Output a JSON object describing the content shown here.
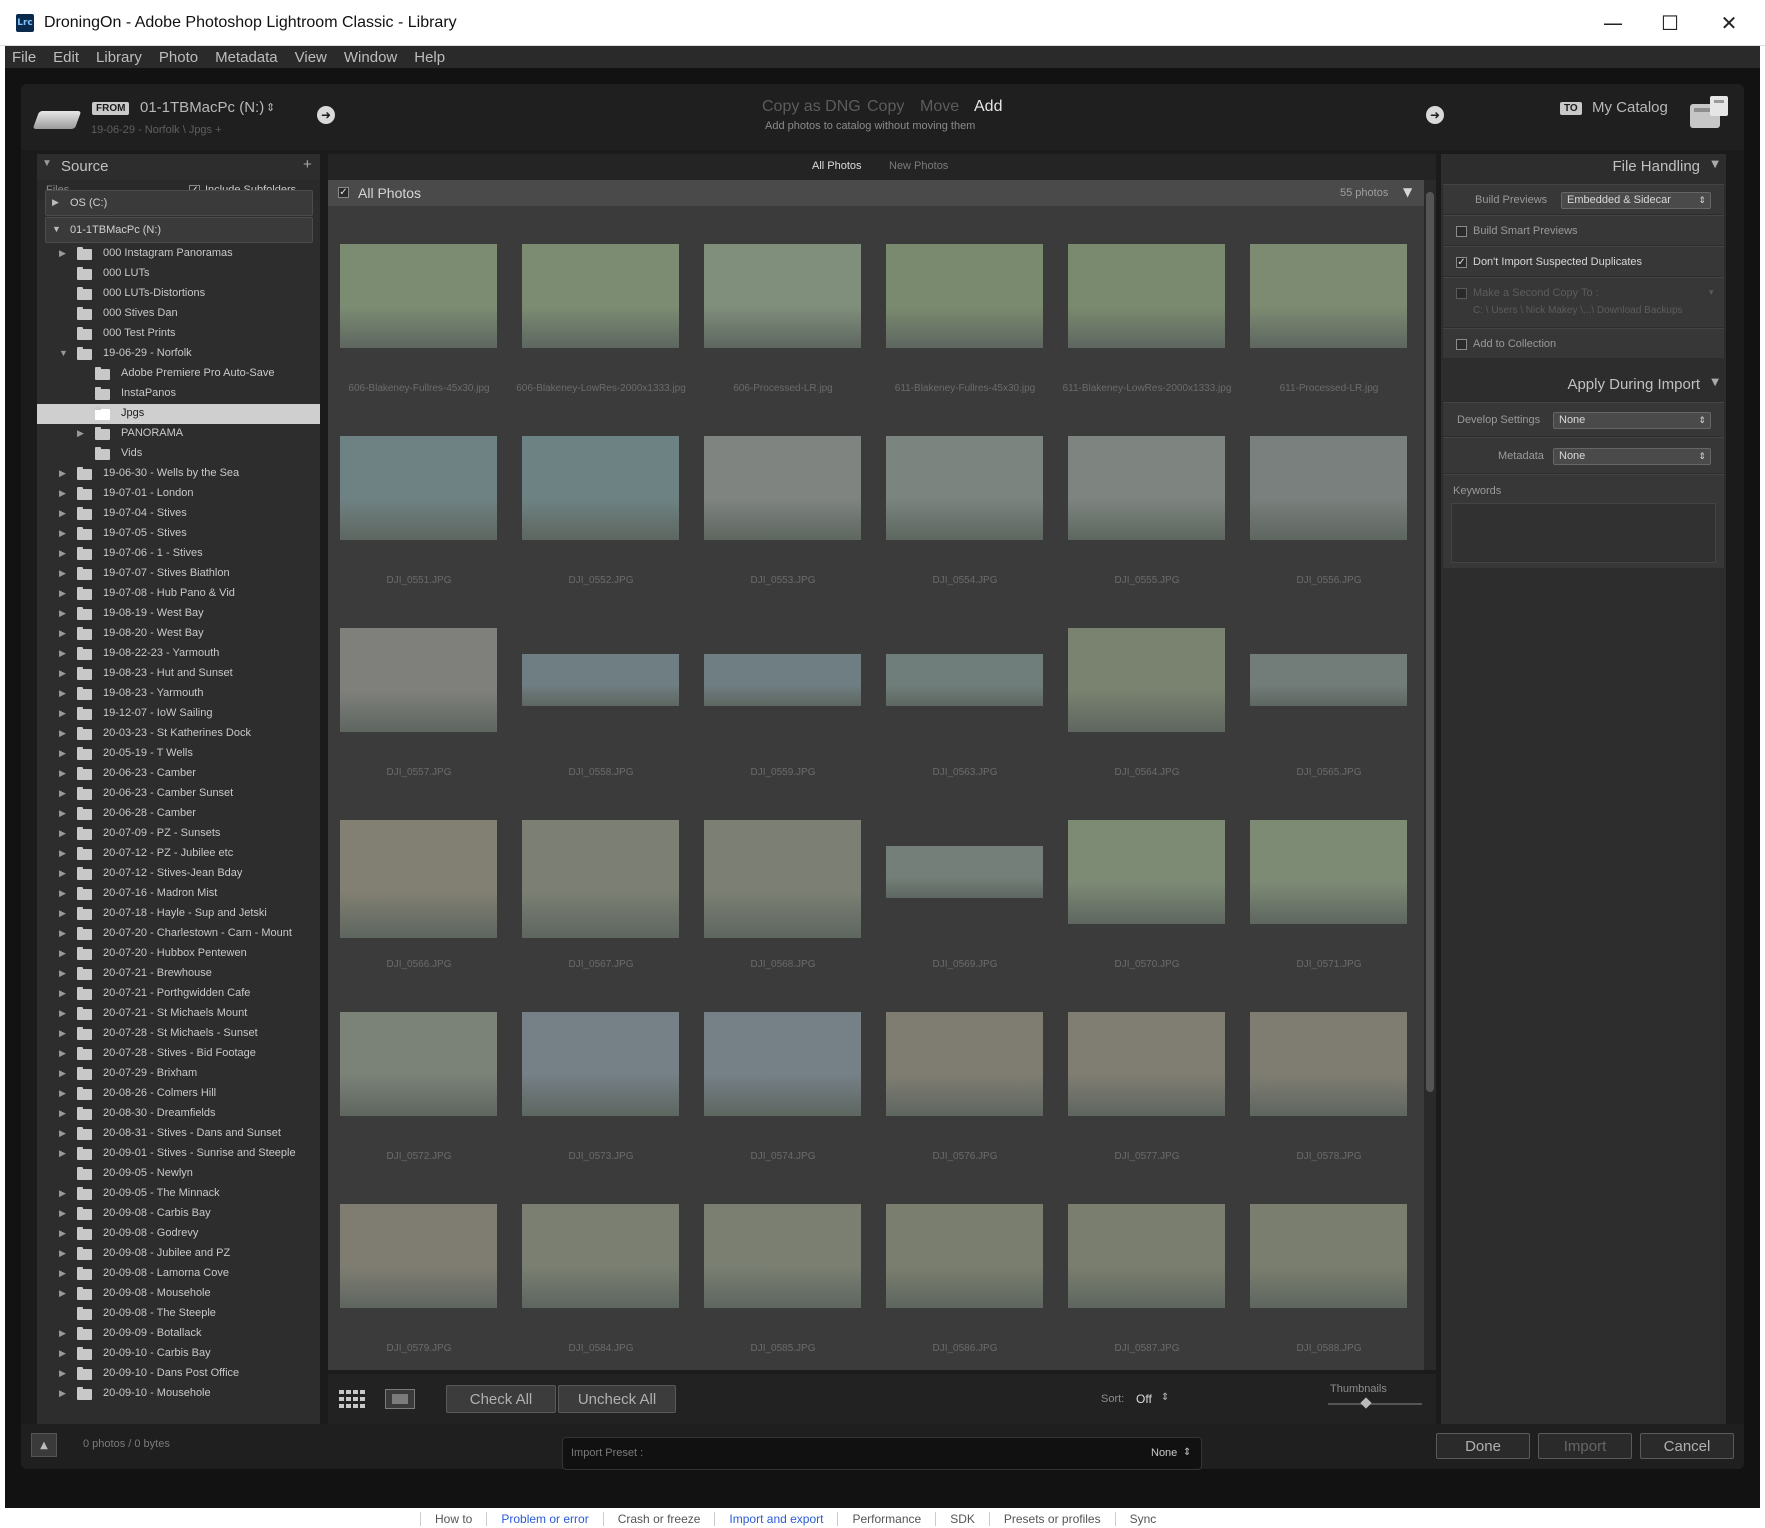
{
  "window": {
    "app_icon": "Lrc",
    "title": "DroningOn - Adobe Photoshop Lightroom Classic - Library",
    "minimize": "—",
    "maximize": "☐",
    "close": "✕"
  },
  "menu": [
    "File",
    "Edit",
    "Library",
    "Photo",
    "Metadata",
    "View",
    "Window",
    "Help"
  ],
  "header": {
    "from_badge": "FROM",
    "source_name": "01-1TBMacPc (N:)",
    "source_path": "19-06-29 - Norfolk \\ Jpgs +",
    "modes": [
      "Copy as DNG",
      "Copy",
      "Move",
      "Add"
    ],
    "active_mode": "Add",
    "mode_desc": "Add photos to catalog without moving them",
    "to_badge": "TO",
    "dest_name": "My Catalog"
  },
  "source_panel": {
    "title": "Source",
    "files_label": "Files",
    "include_subfolders": "Include Subfolders",
    "drives": [
      "OS (C:)",
      "01-1TBMacPc (N:)"
    ],
    "folders": [
      {
        "name": "000 Instagram Panoramas",
        "level": 1,
        "arrow": true
      },
      {
        "name": "000 LUTs",
        "level": 1,
        "arrow": false
      },
      {
        "name": "000 LUTs-Distortions",
        "level": 1,
        "arrow": false
      },
      {
        "name": "000 Stives Dan",
        "level": 1,
        "arrow": false
      },
      {
        "name": "000 Test Prints",
        "level": 1,
        "arrow": false
      },
      {
        "name": "19-06-29 - Norfolk",
        "level": 1,
        "arrow": true,
        "open": true
      },
      {
        "name": "Adobe Premiere Pro Auto-Save",
        "level": 2,
        "arrow": false
      },
      {
        "name": "InstaPanos",
        "level": 2,
        "arrow": false
      },
      {
        "name": "Jpgs",
        "level": 2,
        "arrow": false,
        "selected": true
      },
      {
        "name": "PANORAMA",
        "level": 2,
        "arrow": true
      },
      {
        "name": "Vids",
        "level": 2,
        "arrow": false
      },
      {
        "name": "19-06-30 - Wells by the Sea",
        "level": 1,
        "arrow": true
      },
      {
        "name": "19-07-01 - London",
        "level": 1,
        "arrow": true
      },
      {
        "name": "19-07-04 - Stives",
        "level": 1,
        "arrow": true
      },
      {
        "name": "19-07-05 - Stives",
        "level": 1,
        "arrow": true
      },
      {
        "name": "19-07-06 - 1 - Stives",
        "level": 1,
        "arrow": true
      },
      {
        "name": "19-07-07 - Stives Biathlon",
        "level": 1,
        "arrow": true
      },
      {
        "name": "19-07-08 - Hub Pano & Vid",
        "level": 1,
        "arrow": true
      },
      {
        "name": "19-08-19 - West Bay",
        "level": 1,
        "arrow": true
      },
      {
        "name": "19-08-20 - West Bay",
        "level": 1,
        "arrow": true
      },
      {
        "name": "19-08-22-23 - Yarmouth",
        "level": 1,
        "arrow": true
      },
      {
        "name": "19-08-23 - Hut and Sunset",
        "level": 1,
        "arrow": true
      },
      {
        "name": "19-08-23 - Yarmouth",
        "level": 1,
        "arrow": true
      },
      {
        "name": "19-12-07 - IoW Sailing",
        "level": 1,
        "arrow": true
      },
      {
        "name": "20-03-23 - St Katherines Dock",
        "level": 1,
        "arrow": true
      },
      {
        "name": "20-05-19 - T Wells",
        "level": 1,
        "arrow": true
      },
      {
        "name": "20-06-23 - Camber",
        "level": 1,
        "arrow": true
      },
      {
        "name": "20-06-23 - Camber Sunset",
        "level": 1,
        "arrow": true
      },
      {
        "name": "20-06-28 - Camber",
        "level": 1,
        "arrow": true
      },
      {
        "name": "20-07-09 - PZ - Sunsets",
        "level": 1,
        "arrow": true
      },
      {
        "name": "20-07-12 - PZ - Jubilee etc",
        "level": 1,
        "arrow": true
      },
      {
        "name": "20-07-12 - Stives-Jean Bday",
        "level": 1,
        "arrow": true
      },
      {
        "name": "20-07-16 - Madron Mist",
        "level": 1,
        "arrow": true
      },
      {
        "name": "20-07-18 - Hayle - Sup and Jetski",
        "level": 1,
        "arrow": true
      },
      {
        "name": "20-07-20 - Charlestown - Carn - Mount",
        "level": 1,
        "arrow": true
      },
      {
        "name": "20-07-20 - Hubbox Pentewen",
        "level": 1,
        "arrow": true
      },
      {
        "name": "20-07-21 - Brewhouse",
        "level": 1,
        "arrow": true
      },
      {
        "name": "20-07-21 - Porthgwidden Cafe",
        "level": 1,
        "arrow": true
      },
      {
        "name": "20-07-21 - St Michaels Mount",
        "level": 1,
        "arrow": true
      },
      {
        "name": "20-07-28 - St Michaels - Sunset",
        "level": 1,
        "arrow": true
      },
      {
        "name": "20-07-28 - Stives - Bid Footage",
        "level": 1,
        "arrow": true
      },
      {
        "name": "20-07-29 - Brixham",
        "level": 1,
        "arrow": true
      },
      {
        "name": "20-08-26 - Colmers Hill",
        "level": 1,
        "arrow": true
      },
      {
        "name": "20-08-30 - Dreamfields",
        "level": 1,
        "arrow": true
      },
      {
        "name": "20-08-31 - Stives - Dans and Sunset",
        "level": 1,
        "arrow": true
      },
      {
        "name": "20-09-01 - Stives - Sunrise and Steeple",
        "level": 1,
        "arrow": true
      },
      {
        "name": "20-09-05 - Newlyn",
        "level": 1,
        "arrow": false
      },
      {
        "name": "20-09-05 - The Minnack",
        "level": 1,
        "arrow": true
      },
      {
        "name": "20-09-08 - Carbis Bay",
        "level": 1,
        "arrow": true
      },
      {
        "name": "20-09-08 - Godrevy",
        "level": 1,
        "arrow": true
      },
      {
        "name": "20-09-08 - Jubilee and PZ",
        "level": 1,
        "arrow": true
      },
      {
        "name": "20-09-08 - Lamorna Cove",
        "level": 1,
        "arrow": true
      },
      {
        "name": "20-09-08 - Mousehole",
        "level": 1,
        "arrow": true
      },
      {
        "name": "20-09-08 - The Steeple",
        "level": 1,
        "arrow": false
      },
      {
        "name": "20-09-09 - Botallack",
        "level": 1,
        "arrow": true
      },
      {
        "name": "20-09-10 - Carbis Bay",
        "level": 1,
        "arrow": true
      },
      {
        "name": "20-09-10 - Dans Post Office",
        "level": 1,
        "arrow": true
      },
      {
        "name": "20-09-10 - Mousehole",
        "level": 1,
        "arrow": true
      }
    ]
  },
  "grid": {
    "tabs": [
      "All Photos",
      "New Photos"
    ],
    "header_label": "All Photos",
    "count": "55 photos",
    "photos": [
      {
        "name": "606-Blakeney-Fullres-45x30.jpg",
        "kind": "tall",
        "tone": "#7b8c73"
      },
      {
        "name": "606-Blakeney-LowRes-2000x1333.jpg",
        "kind": "tall",
        "tone": "#7b8c73"
      },
      {
        "name": "606-Processed-LR.jpg",
        "kind": "tall",
        "tone": "#808e7c"
      },
      {
        "name": "611-Blakeney-Fullres-45x30.jpg",
        "kind": "tall",
        "tone": "#7a8a6e"
      },
      {
        "name": "611-Blakeney-LowRes-2000x1333.jpg",
        "kind": "tall",
        "tone": "#7a8a6e"
      },
      {
        "name": "611-Processed-LR.jpg",
        "kind": "tall",
        "tone": "#7d8b72"
      },
      {
        "name": "DJI_0551.JPG",
        "kind": "tall",
        "tone": "#6f8283"
      },
      {
        "name": "DJI_0552.JPG",
        "kind": "tall",
        "tone": "#6d8383"
      },
      {
        "name": "DJI_0553.JPG",
        "kind": "tall",
        "tone": "#7f8480"
      },
      {
        "name": "DJI_0554.JPG",
        "kind": "tall",
        "tone": "#7c8480"
      },
      {
        "name": "DJI_0555.JPG",
        "kind": "tall",
        "tone": "#7e8580"
      },
      {
        "name": "DJI_0556.JPG",
        "kind": "tall",
        "tone": "#7a807d"
      },
      {
        "name": "DJI_0557.JPG",
        "kind": "tall",
        "tone": "#7f807c"
      },
      {
        "name": "DJI_0558.JPG",
        "kind": "wide",
        "tone": "#6f7e82"
      },
      {
        "name": "DJI_0559.JPG",
        "kind": "wide",
        "tone": "#6f7e82"
      },
      {
        "name": "DJI_0563.JPG",
        "kind": "wide",
        "tone": "#6f7e7a"
      },
      {
        "name": "DJI_0564.JPG",
        "kind": "tall",
        "tone": "#7a8270"
      },
      {
        "name": "DJI_0565.JPG",
        "kind": "wide",
        "tone": "#727c79"
      },
      {
        "name": "DJI_0566.JPG",
        "kind": "taller",
        "tone": "#828072"
      },
      {
        "name": "DJI_0567.JPG",
        "kind": "taller",
        "tone": "#7c8074"
      },
      {
        "name": "DJI_0568.JPG",
        "kind": "taller",
        "tone": "#7c8074"
      },
      {
        "name": "DJI_0569.JPG",
        "kind": "wide",
        "tone": "#737f78"
      },
      {
        "name": "DJI_0570.JPG",
        "kind": "tall",
        "tone": "#7d8a74"
      },
      {
        "name": "DJI_0571.JPG",
        "kind": "tall",
        "tone": "#7d8a74"
      },
      {
        "name": "DJI_0572.JPG",
        "kind": "tall",
        "tone": "#7b8278"
      },
      {
        "name": "DJI_0573.JPG",
        "kind": "tall",
        "tone": "#758087"
      },
      {
        "name": "DJI_0574.JPG",
        "kind": "tall",
        "tone": "#768087"
      },
      {
        "name": "DJI_0576.JPG",
        "kind": "tall",
        "tone": "#7f7d72"
      },
      {
        "name": "DJI_0577.JPG",
        "kind": "tall",
        "tone": "#807d72"
      },
      {
        "name": "DJI_0578.JPG",
        "kind": "tall",
        "tone": "#7f7d72"
      },
      {
        "name": "DJI_0579.JPG",
        "kind": "tall",
        "tone": "#7f7d72"
      },
      {
        "name": "DJI_0584.JPG",
        "kind": "tall",
        "tone": "#7a7f72"
      },
      {
        "name": "DJI_0585.JPG",
        "kind": "tall",
        "tone": "#7a7f72"
      },
      {
        "name": "DJI_0586.JPG",
        "kind": "tall",
        "tone": "#7a7e6e"
      },
      {
        "name": "DJI_0587.JPG",
        "kind": "tall",
        "tone": "#7a7e6e"
      },
      {
        "name": "DJI_0588.JPG",
        "kind": "tall",
        "tone": "#7a7e6e"
      }
    ]
  },
  "toolbar": {
    "check_all": "Check All",
    "uncheck_all": "Uncheck All",
    "sort_label": "Sort:",
    "sort_value": "Off",
    "thumbnails_label": "Thumbnails",
    "thumbnail_size": 0.4
  },
  "file_handling": {
    "title": "File Handling",
    "build_previews_label": "Build Previews",
    "build_previews_value": "Embedded & Sidecar",
    "build_smart_previews": "Build Smart Previews",
    "dont_import_duplicates": "Don't Import Suspected Duplicates",
    "second_copy": "Make a Second Copy To :",
    "second_copy_path": "C: \\ Users \\ Nick Makey \\...\\ Download Backups",
    "add_to_collection": "Add to Collection"
  },
  "apply_during_import": {
    "title": "Apply During Import",
    "develop_label": "Develop Settings",
    "develop_value": "None",
    "metadata_label": "Metadata",
    "metadata_value": "None",
    "keywords_label": "Keywords"
  },
  "bottom": {
    "status": "0 photos / 0 bytes",
    "import_preset_label": "Import Preset :",
    "import_preset_value": "None",
    "done": "Done",
    "import": "Import",
    "cancel": "Cancel"
  },
  "taskbar_strip": [
    "How to",
    "Problem or error",
    "Crash or freeze",
    "Import and export",
    "Performance",
    "SDK",
    "Presets or profiles",
    "Sync"
  ]
}
